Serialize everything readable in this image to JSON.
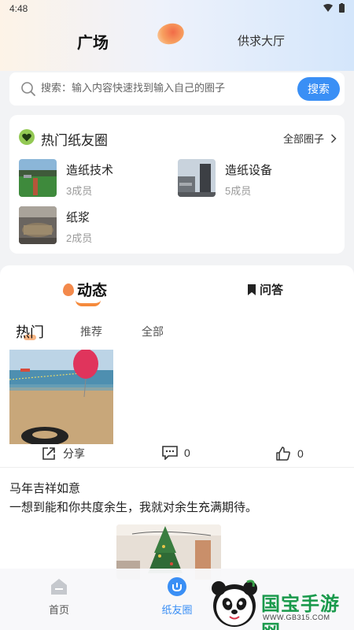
{
  "status_bar": {
    "time": "4:48"
  },
  "header": {
    "tab_square": "广场",
    "tab_market": "供求大厅"
  },
  "search": {
    "placeholder": "搜索：输入内容快速找到输入自己的圈子",
    "button_label": "搜索"
  },
  "circles": {
    "title": "热门纸友圈",
    "all_link": "全部圈子",
    "items": [
      {
        "name": "造纸技术",
        "members": "3成员"
      },
      {
        "name": "造纸设备",
        "members": "5成员"
      },
      {
        "name": "纸浆",
        "members": "2成员"
      }
    ]
  },
  "feed": {
    "tab_dynamic": "动态",
    "tab_qa": "问答",
    "subtabs": [
      "热门",
      "推荐",
      "全部"
    ],
    "post": {
      "share_label": "分享",
      "comment_count": "0",
      "like_count": "0",
      "title": "马年吉祥如意",
      "body": "一想到能和你共度余生，我就对余生充满期待。"
    }
  },
  "tabbar": {
    "home": "首页",
    "circles": "纸友圈"
  },
  "watermark": {
    "name": "国宝手游网",
    "url": "WWW.GB315.COM"
  },
  "colors": {
    "accent": "#3a8ff5",
    "orange": "#f58a3c",
    "green": "#93c954"
  }
}
